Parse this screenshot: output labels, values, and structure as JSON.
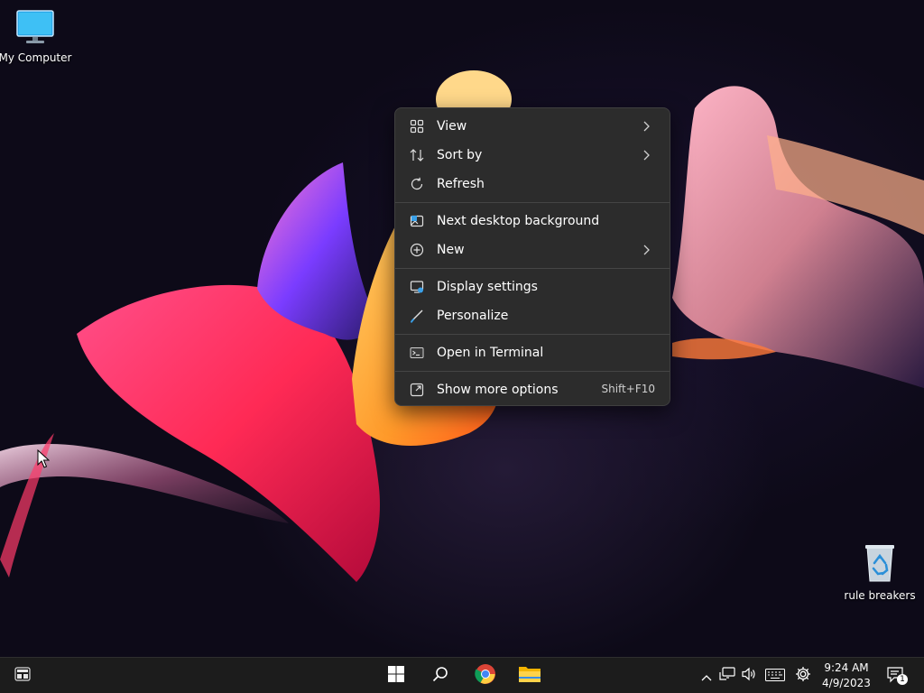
{
  "desktop": {
    "icons": [
      {
        "label": "My Computer",
        "icon": "monitor-icon"
      },
      {
        "label": "rule breakers",
        "icon": "recycle-bin-icon"
      }
    ]
  },
  "context_menu": {
    "items": [
      {
        "label": "View",
        "icon": "grid-icon",
        "submenu": true
      },
      {
        "label": "Sort by",
        "icon": "sort-arrows-icon",
        "submenu": true
      },
      {
        "label": "Refresh",
        "icon": "refresh-icon"
      },
      {
        "label": "Next desktop background",
        "icon": "next-background-icon"
      },
      {
        "label": "New",
        "icon": "plus-circle-icon",
        "submenu": true
      },
      {
        "label": "Display settings",
        "icon": "display-settings-icon"
      },
      {
        "label": "Personalize",
        "icon": "brush-icon"
      },
      {
        "label": "Open in Terminal",
        "icon": "terminal-icon"
      },
      {
        "label": "Show more options",
        "icon": "more-options-icon",
        "shortcut": "Shift+F10"
      }
    ]
  },
  "taskbar": {
    "apps": [
      "widgets-icon",
      "start-icon",
      "search-icon",
      "chrome-icon",
      "file-explorer-icon"
    ],
    "tray": [
      "chevron-up-icon",
      "network-icon",
      "volume-icon",
      "keyboard-icon",
      "settings-icon"
    ],
    "clock": {
      "time": "9:24 AM",
      "date": "4/9/2023"
    },
    "notification_count": "1"
  },
  "colors": {
    "menu_bg": "#2c2c2c",
    "taskbar_bg": "#1c1c1c",
    "accent": "#3aa0e8"
  }
}
